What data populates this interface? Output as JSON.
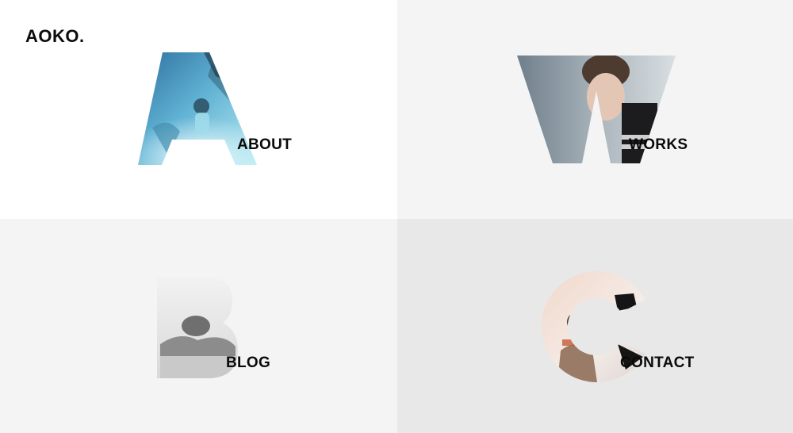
{
  "brand": {
    "logo_text": "AOKO."
  },
  "nav": {
    "items": [
      {
        "letter": "A",
        "label": "ABOUT"
      },
      {
        "letter": "W",
        "label": "WORKS"
      },
      {
        "letter": "B",
        "label": "BLOG"
      },
      {
        "letter": "C",
        "label": "CONTACT"
      }
    ]
  },
  "colors": {
    "text": "#0a0a0a",
    "quad_white": "#ffffff",
    "quad_light": "#f4f4f4",
    "quad_mid": "#e8e8e8"
  },
  "icons": {
    "about": "letter-a-photo-mask-icon",
    "works": "letter-w-photo-mask-icon",
    "blog": "letter-b-photo-mask-icon",
    "contact": "letter-c-photo-mask-icon"
  }
}
